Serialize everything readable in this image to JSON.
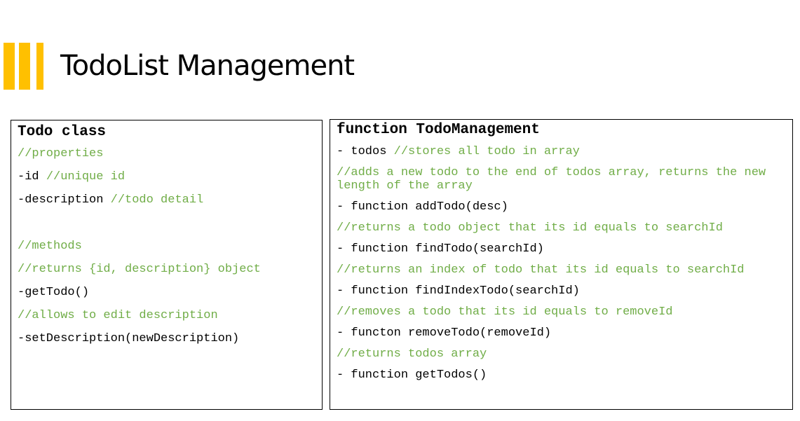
{
  "title": "TodoList Management",
  "colors": {
    "accent": "#ffc000",
    "comment": "#70ad47",
    "code": "#000000"
  },
  "todo_class": {
    "heading": "Todo class",
    "lines": [
      {
        "type": "comment",
        "text": "//properties"
      },
      {
        "type": "code",
        "text": "-id ",
        "comment": "//unique id"
      },
      {
        "type": "code",
        "text": "-description ",
        "comment": "//todo detail"
      },
      {
        "type": "spacer",
        "text": ""
      },
      {
        "type": "comment",
        "text": "//methods"
      },
      {
        "type": "comment",
        "text": "//returns {id, description} object"
      },
      {
        "type": "code",
        "text": "-getTodo()"
      },
      {
        "type": "comment",
        "text": "//allows to edit description"
      },
      {
        "type": "code",
        "text": "-setDescription(newDescription)"
      }
    ]
  },
  "todo_management": {
    "heading": "function TodoManagement",
    "lines": [
      {
        "type": "code",
        "text": "- todos ",
        "comment": "//stores all todo in array"
      },
      {
        "type": "comment",
        "text": "//adds a new todo to the end of todos array, returns the new length of the array"
      },
      {
        "type": "code",
        "text": "- function addTodo(desc)"
      },
      {
        "type": "comment",
        "text": "//returns a todo object that its id equals to searchId"
      },
      {
        "type": "code",
        "text": "- function findTodo(searchId)"
      },
      {
        "type": "comment",
        "text": "//returns an index of todo that its id equals to searchId"
      },
      {
        "type": "code",
        "text": "- function findIndexTodo(searchId)"
      },
      {
        "type": "comment",
        "text": "//removes a todo that its id equals to removeId"
      },
      {
        "type": "code",
        "text": "- functon removeTodo(removeId)"
      },
      {
        "type": "comment",
        "text": "//returns todos array"
      },
      {
        "type": "code",
        "text": "- function getTodos()"
      }
    ]
  }
}
